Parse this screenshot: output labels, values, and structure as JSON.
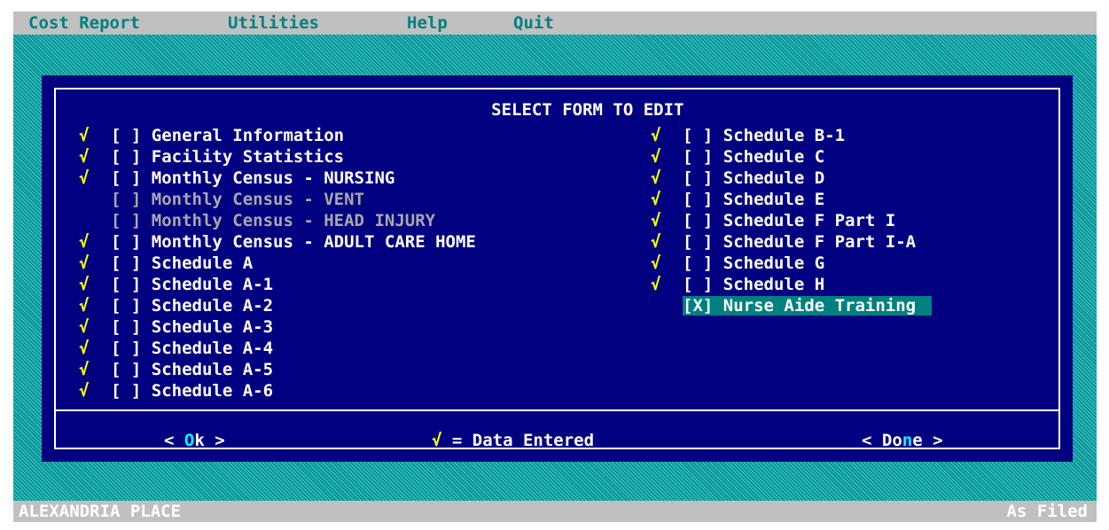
{
  "menu": {
    "cost_report": "Cost Report",
    "utilities": "Utilities",
    "help": "Help",
    "quit": "Quit"
  },
  "dialog": {
    "title": "SELECT FORM TO EDIT",
    "check_symbol": "√",
    "checkbox_empty": "[ ]",
    "checkbox_checked": "[X]",
    "left_items": [
      {
        "label": "General Information",
        "data_entered": true,
        "enabled": true,
        "selected": false
      },
      {
        "label": "Facility Statistics",
        "data_entered": true,
        "enabled": true,
        "selected": false
      },
      {
        "label": "Monthly Census - NURSING",
        "data_entered": true,
        "enabled": true,
        "selected": false
      },
      {
        "label": "Monthly Census - VENT",
        "data_entered": false,
        "enabled": false,
        "selected": false
      },
      {
        "label": "Monthly Census - HEAD INJURY",
        "data_entered": false,
        "enabled": false,
        "selected": false
      },
      {
        "label": "Monthly Census - ADULT CARE HOME",
        "data_entered": true,
        "enabled": true,
        "selected": false
      },
      {
        "label": "Schedule A",
        "data_entered": true,
        "enabled": true,
        "selected": false
      },
      {
        "label": "Schedule A-1",
        "data_entered": true,
        "enabled": true,
        "selected": false
      },
      {
        "label": "Schedule A-2",
        "data_entered": true,
        "enabled": true,
        "selected": false
      },
      {
        "label": "Schedule A-3",
        "data_entered": true,
        "enabled": true,
        "selected": false
      },
      {
        "label": "Schedule A-4",
        "data_entered": true,
        "enabled": true,
        "selected": false
      },
      {
        "label": "Schedule A-5",
        "data_entered": true,
        "enabled": true,
        "selected": false
      },
      {
        "label": "Schedule A-6",
        "data_entered": true,
        "enabled": true,
        "selected": false
      }
    ],
    "right_items": [
      {
        "label": "Schedule B-1",
        "data_entered": true,
        "enabled": true,
        "selected": false
      },
      {
        "label": "Schedule C",
        "data_entered": true,
        "enabled": true,
        "selected": false
      },
      {
        "label": "Schedule D",
        "data_entered": true,
        "enabled": true,
        "selected": false
      },
      {
        "label": "Schedule E",
        "data_entered": true,
        "enabled": true,
        "selected": false
      },
      {
        "label": "Schedule F Part I",
        "data_entered": true,
        "enabled": true,
        "selected": false
      },
      {
        "label": "Schedule F Part I-A",
        "data_entered": true,
        "enabled": true,
        "selected": false
      },
      {
        "label": "Schedule G",
        "data_entered": true,
        "enabled": true,
        "selected": false
      },
      {
        "label": "Schedule H",
        "data_entered": true,
        "enabled": true,
        "selected": false
      },
      {
        "label": "Nurse Aide Training",
        "data_entered": false,
        "enabled": true,
        "selected": true
      }
    ],
    "ok_button": {
      "prefix": "< ",
      "hotkey": "O",
      "rest": "k",
      "suffix": " >"
    },
    "done_button": {
      "prefix": "< ",
      "main": "Do",
      "hotkey": "n",
      "rest": "e",
      "suffix": " >"
    },
    "legend": {
      "check": "√",
      "text": " = Data Entered"
    }
  },
  "status_bar": {
    "facility": "ALEXANDRIA PLACE",
    "mode": "As Filed"
  },
  "colors": {
    "desktop": "#0da0a0",
    "dialog_bg": "#000080",
    "menu_bar": "#c0c0c0",
    "menu_text": "#008080",
    "check_mark": "#ffff00",
    "selected_bg": "#008080",
    "disabled_text": "#a8a8a8",
    "hotkey": "#00ffff"
  }
}
